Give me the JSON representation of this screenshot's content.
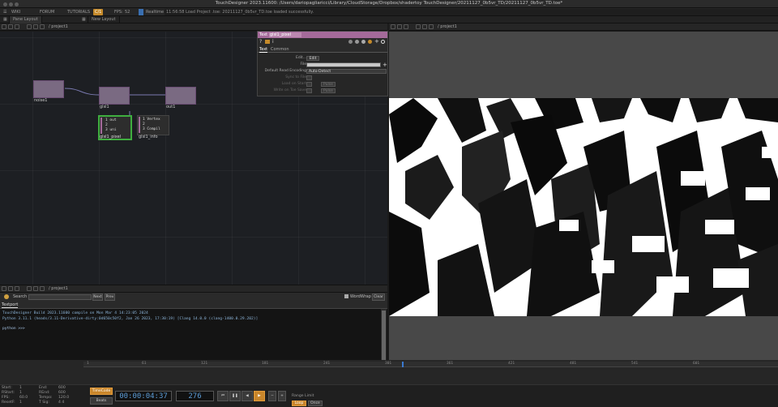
{
  "window": {
    "title": "TouchDesigner 2023.11600: /Users/dariopagliaricci/Library/CloudStorage/Dropbox/shadertoy TouchDesigner/20211127_0b5vr_TD/20211127_0b5vr_TD.toe*"
  },
  "menubar": {
    "items": [
      "WIKI",
      "FORUM",
      "TUTORIALS"
    ],
    "fps_badge": "C/1",
    "fps_label": "FPS:",
    "fps_value": "52",
    "realtime": "Realtime",
    "status": "11:56:58 Load Project .toe: 20211127_0b5vr_TD.toe loaded successfully."
  },
  "tabs": {
    "pane_layout": "Pane Layout",
    "new_layout": "New Layout"
  },
  "network": {
    "path": "/ project1",
    "nodes": {
      "noise1": "noise1",
      "glsl1": "glsl1",
      "out1": "out1",
      "glsl1_pixel": "glsl1_pixel",
      "glsl1_info": "glsl1_info",
      "glsl1_pixel_preview": [
        "1  out",
        "2",
        "3  uni"
      ],
      "glsl1_info_preview": [
        "1  Vertex",
        "2",
        "3  Compil"
      ]
    }
  },
  "params": {
    "type": "Text",
    "name": "glsl1_pixel",
    "subtabs": [
      "Text",
      "Common"
    ],
    "rows": [
      {
        "label": "Edit...",
        "value": "Edit"
      },
      {
        "label": "File",
        "value": ""
      },
      {
        "label": "Default Read Encoding",
        "value": "Auto-Detect"
      },
      {
        "label": "Sync to File",
        "value": ""
      },
      {
        "label": "Load on Start",
        "value": "Pulse"
      },
      {
        "label": "Write on Toe Save",
        "value": "Pulse"
      }
    ]
  },
  "viewer": {
    "path": "/ project1"
  },
  "textport": {
    "path": "/ project1",
    "search_label": "Search",
    "next": "Next",
    "prev": "Prev",
    "wordwrap": "WordWrap",
    "clear": "Clear",
    "tab": "Textport",
    "lines": [
      "TouchDesigner  Build 2023.11600 compile on Mon Mar  4 14:23:05 2024",
      "Python 3.11.1 (heads/3.11-Derivative-dirty:0d650c50f2, Jan 26 2023, 17:30:19) [Clang 14.0.0 (clang-1400.0.29.202)]",
      "",
      "python >>>"
    ]
  },
  "timeline": {
    "ticks": [
      "1",
      "61",
      "121",
      "181",
      "241",
      "301",
      "361",
      "421",
      "481",
      "541",
      "601"
    ]
  },
  "transport": {
    "stats": [
      {
        "label": "Start:",
        "value": "1",
        "label2": "End:",
        "value2": "600"
      },
      {
        "label": "RStart:",
        "value": "1",
        "label2": "REnd:",
        "value2": "600"
      },
      {
        "label": "FPS:",
        "value": "60.0",
        "label2": "Tempo:",
        "value2": "120.0"
      },
      {
        "label": "ResetF:",
        "value": "1",
        "label2": "T Sig:",
        "value2": "4   4"
      }
    ],
    "timecode_label": "TimeCode",
    "beats_label": "Beats",
    "timecode": "00:00:04:37",
    "frame": "276",
    "range_label": "Range Limit",
    "loop_label": "Loop",
    "once_label": "Once"
  },
  "colors": {
    "accent_orange": "#c9862b",
    "text_op": "#a46a9a",
    "timecode_blue": "#5b9bd5"
  }
}
